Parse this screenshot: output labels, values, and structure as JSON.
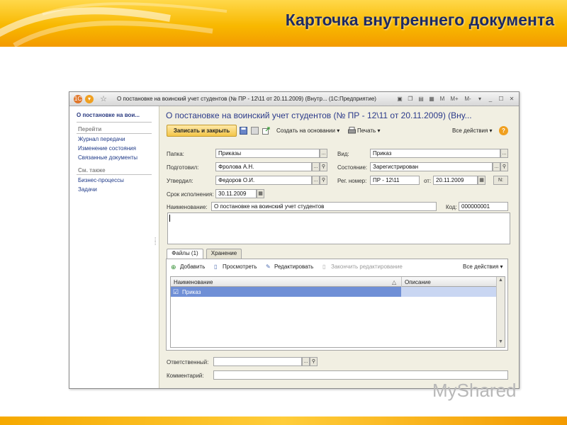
{
  "slide": {
    "title": "Карточка внутреннего документа",
    "watermark": "MyShared"
  },
  "window": {
    "title": "О постановке на воинский учет студентов (№ ПР - 12\\11 от 20.11.2009) (Внутр... (1С:Предприятие)",
    "tools": [
      "M",
      "M+",
      "M-"
    ]
  },
  "sidebar": {
    "doc_link": "О постановке на вои...",
    "section_go": "Перейти",
    "go_items": [
      "Журнал передачи",
      "Изменение состояния",
      "Связанные документы"
    ],
    "section_see_also": "См. также",
    "see_also_items": [
      "Бизнес-процессы",
      "Задачи"
    ]
  },
  "form": {
    "title": "О постановке на воинский учет студентов (№ ПР - 12\\11 от 20.11.2009) (Вну...",
    "toolbar": {
      "save_close": "Записать и закрыть",
      "create_based": "Создать на основании",
      "print": "Печать",
      "all_actions": "Все действия"
    },
    "fields": {
      "folder_label": "Папка:",
      "folder_value": "Приказы",
      "prepared_label": "Подготовил:",
      "prepared_value": "Фролова А.Н.",
      "approved_label": "Утвердил:",
      "approved_value": "Федоров О.И.",
      "deadline_label": "Срок исполнения:",
      "deadline_value": "30.11.2009",
      "type_label": "Вид:",
      "type_value": "Приказ",
      "state_label": "Состояние:",
      "state_value": "Зарегистрирован",
      "regnum_label": "Рег. номер:",
      "regnum_value": "ПР - 12\\11",
      "from_label": "от:",
      "from_value": "20.11.2009",
      "num_button": "N:",
      "name_label": "Наименование:",
      "name_value": "О постановке на воинский учет студентов",
      "code_label": "Код:",
      "code_value": "000000001",
      "responsible_label": "Ответственный:",
      "responsible_value": "",
      "comment_label": "Комментарий:",
      "comment_value": ""
    },
    "tabs": [
      "Файлы (1)",
      "Хранение"
    ],
    "files_toolbar": {
      "add": "Добавить",
      "view": "Просмотреть",
      "edit": "Редактировать",
      "finish_edit": "Закончить редактирование",
      "all_actions": "Все действия"
    },
    "grid": {
      "columns": [
        "Наименование",
        "Описание"
      ],
      "rows": [
        {
          "name": "Приказ",
          "description": ""
        }
      ]
    }
  },
  "colors": {
    "accent": "#f8b800",
    "title_text": "#1d2a63",
    "link": "#1f3a88",
    "selected_row": "#6f8fd6"
  }
}
